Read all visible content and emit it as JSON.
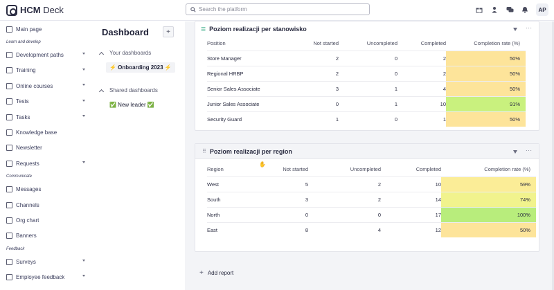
{
  "brand": {
    "name_bold": "HCM",
    "name_light": " Deck"
  },
  "search": {
    "placeholder": "Search the platform"
  },
  "user": {
    "initials": "AP"
  },
  "sidebar": {
    "items": [
      {
        "label": "Main page",
        "chevron": false
      },
      {
        "section": "Learn and develop"
      },
      {
        "label": "Development paths",
        "chevron": true
      },
      {
        "label": "Training",
        "chevron": true
      },
      {
        "label": "Online courses",
        "chevron": true
      },
      {
        "label": "Tests",
        "chevron": true
      },
      {
        "label": "Tasks",
        "chevron": true
      },
      {
        "label": "Knowledge base",
        "chevron": false
      },
      {
        "label": "Newsletter",
        "chevron": false
      },
      {
        "label": "Requests",
        "chevron": true
      },
      {
        "section": "Communicate"
      },
      {
        "label": "Messages",
        "chevron": false
      },
      {
        "label": "Channels",
        "chevron": false
      },
      {
        "label": "Org chart",
        "chevron": false
      },
      {
        "label": "Banners",
        "chevron": false
      },
      {
        "section": "Feedback"
      },
      {
        "label": "Surveys",
        "chevron": true
      },
      {
        "label": "Employee feedback",
        "chevron": true
      }
    ]
  },
  "dashboard": {
    "title": "Dashboard",
    "add_label": "+",
    "your_group": "Your dashboards",
    "your_item": "⚡ Onboarding 2023 ⚡",
    "shared_group": "Shared dashboards",
    "shared_item": "✅ New leader ✅"
  },
  "report1": {
    "title": "Poziom realizacji per stanowisko",
    "columns": [
      "Position",
      "Not started",
      "Uncompleted",
      "Completed",
      "Completion rate (%)"
    ],
    "rows": [
      {
        "name": "Store Manager",
        "not_started": "2",
        "uncompleted": "0",
        "completed": "2",
        "rate": "50%",
        "color": "#fde49a"
      },
      {
        "name": "Regional HRBP",
        "not_started": "2",
        "uncompleted": "0",
        "completed": "2",
        "rate": "50%",
        "color": "#fde49a"
      },
      {
        "name": "Senior Sales Associate",
        "not_started": "3",
        "uncompleted": "1",
        "completed": "4",
        "rate": "50%",
        "color": "#fde49a"
      },
      {
        "name": "Junior Sales Associate",
        "not_started": "0",
        "uncompleted": "1",
        "completed": "10",
        "rate": "91%",
        "color": "#c9f17e"
      },
      {
        "name": "Security Guard",
        "not_started": "1",
        "uncompleted": "0",
        "completed": "1",
        "rate": "50%",
        "color": "#fde49a"
      }
    ]
  },
  "report2": {
    "title": "Poziom realizacji per region",
    "columns": [
      "Region",
      "Not started",
      "Uncompleted",
      "Completed",
      "Completion rate (%)"
    ],
    "rows": [
      {
        "name": "West",
        "not_started": "5",
        "uncompleted": "2",
        "completed": "10",
        "rate": "59%",
        "color": "#fbed97"
      },
      {
        "name": "South",
        "not_started": "3",
        "uncompleted": "2",
        "completed": "14",
        "rate": "74%",
        "color": "#f1f38d"
      },
      {
        "name": "North",
        "not_started": "0",
        "uncompleted": "0",
        "completed": "17",
        "rate": "100%",
        "color": "#b8ed7c"
      },
      {
        "name": "East",
        "not_started": "8",
        "uncompleted": "4",
        "completed": "12",
        "rate": "50%",
        "color": "#fde49a"
      }
    ]
  },
  "footer": {
    "add_report": "Add report"
  }
}
